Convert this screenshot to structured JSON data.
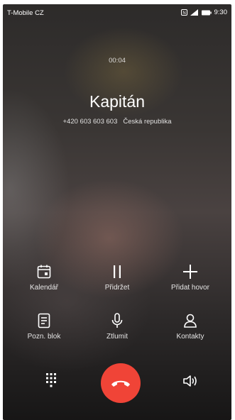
{
  "status_bar": {
    "carrier": "T-Mobile CZ",
    "time": "9:30",
    "icons": [
      "nfc-icon",
      "signal-icon",
      "battery-icon"
    ]
  },
  "call": {
    "duration": "00:04",
    "contact_name": "Kapitán",
    "phone_number": "+420 603 603 603",
    "location": "Česká republika"
  },
  "actions": {
    "calendar": {
      "label": "Kalendář",
      "icon": "calendar-icon"
    },
    "hold": {
      "label": "Přidržet",
      "icon": "pause-icon"
    },
    "add_call": {
      "label": "Přidat hovor",
      "icon": "plus-icon"
    },
    "notes": {
      "label": "Pozn. blok",
      "icon": "notepad-icon"
    },
    "mute": {
      "label": "Ztlumit",
      "icon": "microphone-icon"
    },
    "contacts": {
      "label": "Kontakty",
      "icon": "person-icon"
    }
  },
  "controls": {
    "dialpad_icon": "dialpad-icon",
    "end_call_icon": "phone-hangup-icon",
    "speaker_icon": "speaker-icon",
    "end_call_color": "#f04437"
  }
}
